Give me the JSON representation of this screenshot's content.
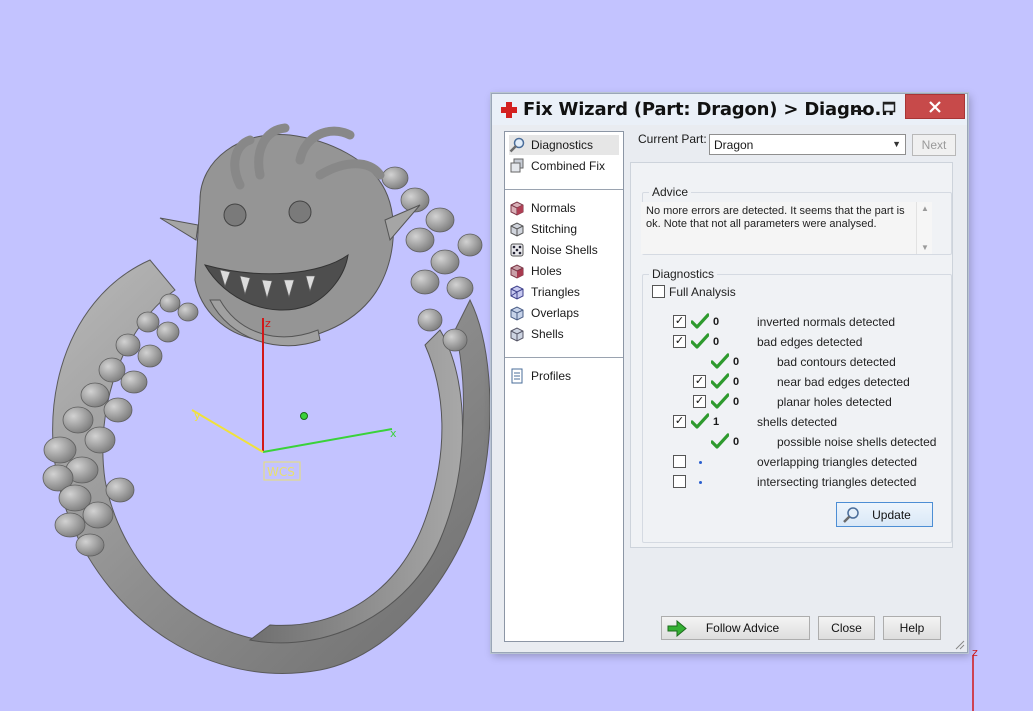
{
  "viewport": {
    "axes": {
      "x_label": "x",
      "y_label": "y",
      "z_label": "z",
      "wcs_label": "WCS"
    },
    "corner_axis_label": "z",
    "colors": {
      "background": "#c3c3ff",
      "model": "#8c8c8c",
      "x_axis": "#3ad23a",
      "y_axis": "#f0e23a",
      "z_axis": "#d21818"
    }
  },
  "window": {
    "title": "Fix Wizard (Part: Dragon) > Diagno...",
    "controls": {
      "minimize": "minimize-icon",
      "maximize": "maximize-icon",
      "close": "close-icon"
    }
  },
  "nav": {
    "groups": [
      [
        {
          "label": "Diagnostics",
          "icon": "magnifier-icon",
          "selected": true
        },
        {
          "label": "Combined Fix",
          "icon": "combined-fix-icon"
        }
      ],
      [
        {
          "label": "Normals",
          "icon": "normals-cube-icon"
        },
        {
          "label": "Stitching",
          "icon": "stitching-cube-icon"
        },
        {
          "label": "Noise Shells",
          "icon": "dice-icon"
        },
        {
          "label": "Holes",
          "icon": "holes-cube-icon"
        },
        {
          "label": "Triangles",
          "icon": "triangles-cube-icon"
        },
        {
          "label": "Overlaps",
          "icon": "overlaps-cube-icon"
        },
        {
          "label": "Shells",
          "icon": "shells-cube-icon"
        }
      ],
      [
        {
          "label": "Profiles",
          "icon": "document-icon"
        }
      ]
    ]
  },
  "header": {
    "current_part_label": "Current Part:",
    "current_part_value": "Dragon",
    "next_label": "Next"
  },
  "advice": {
    "legend": "Advice",
    "text": "No more errors are detected. It seems that the part is ok. Note that not all parameters were analysed."
  },
  "diagnostics": {
    "legend": "Diagnostics",
    "full_analysis_label": "Full Analysis",
    "full_analysis_checked": false,
    "rows": [
      {
        "checkbox": true,
        "checked": true,
        "status": "ok",
        "count": "0",
        "label": "inverted normals detected",
        "indent": 0
      },
      {
        "checkbox": true,
        "checked": true,
        "status": "ok",
        "count": "0",
        "label": "bad edges detected",
        "indent": 0
      },
      {
        "checkbox": false,
        "checked": false,
        "status": "ok",
        "count": "0",
        "label": "bad contours detected",
        "indent": 1
      },
      {
        "checkbox": true,
        "checked": true,
        "status": "ok",
        "count": "0",
        "label": "near bad edges detected",
        "indent": 1
      },
      {
        "checkbox": true,
        "checked": true,
        "status": "ok",
        "count": "0",
        "label": "planar holes detected",
        "indent": 1
      },
      {
        "checkbox": true,
        "checked": true,
        "status": "ok",
        "count": "1",
        "label": "shells detected",
        "indent": 0
      },
      {
        "checkbox": false,
        "checked": false,
        "status": "ok",
        "count": "0",
        "label": "possible noise shells detected",
        "indent": 1
      },
      {
        "checkbox": true,
        "checked": false,
        "status": "dot",
        "count": "",
        "label": "overlapping triangles detected",
        "indent": 0
      },
      {
        "checkbox": true,
        "checked": false,
        "status": "dot",
        "count": "",
        "label": "intersecting triangles detected",
        "indent": 0
      }
    ],
    "update_label": "Update"
  },
  "footer": {
    "follow_advice_label": "Follow Advice",
    "close_label": "Close",
    "help_label": "Help"
  }
}
